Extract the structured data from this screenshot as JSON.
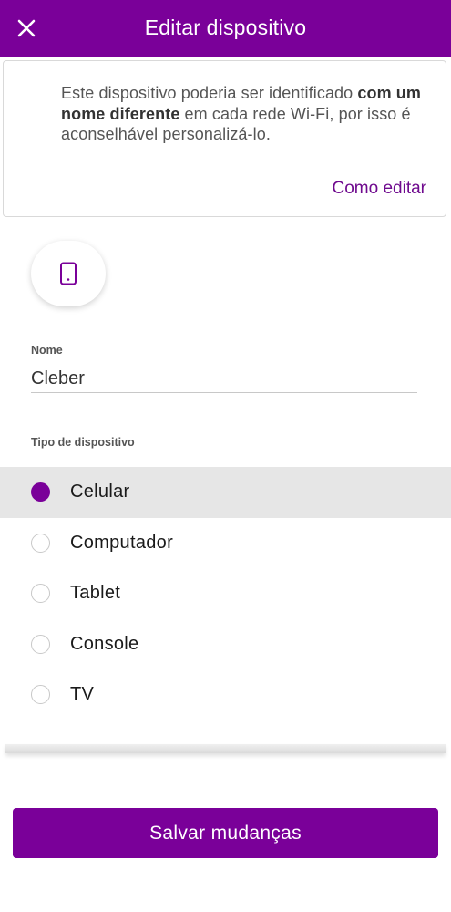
{
  "header": {
    "title": "Editar dispositivo",
    "close_icon": "close-icon"
  },
  "info": {
    "text_part1": "Este dispositivo poderia ser identificado ",
    "text_bold": "com um nome diferente",
    "text_part2": " em cada rede Wi-Fi, por isso é aconselhável personalizá-lo.",
    "link": "Como editar"
  },
  "device_icon": "smartphone-icon",
  "name_field": {
    "label": "Nome",
    "value": "Cleber"
  },
  "device_type": {
    "label": "Tipo de dispositivo",
    "options": [
      {
        "label": "Celular",
        "selected": true
      },
      {
        "label": "Computador",
        "selected": false
      },
      {
        "label": "Tablet",
        "selected": false
      },
      {
        "label": "Console",
        "selected": false
      },
      {
        "label": "TV",
        "selected": false
      }
    ]
  },
  "save_label": "Salvar mudanças",
  "colors": {
    "accent": "#7a0099",
    "link": "#6f0a8e",
    "selected_row": "#e6e6e6"
  }
}
